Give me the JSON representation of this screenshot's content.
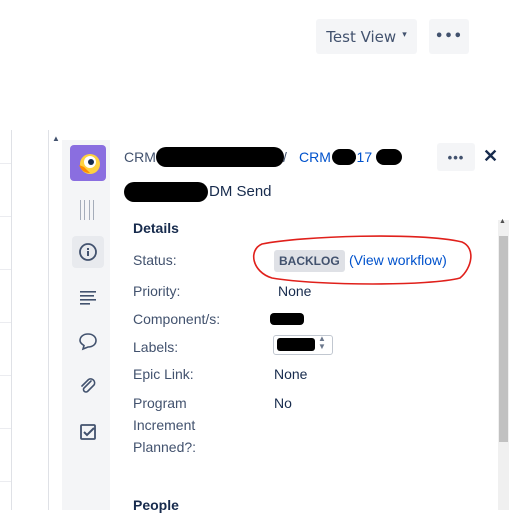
{
  "toolbar": {
    "view_label": "Test View",
    "view_caret": "▾",
    "more_label": "•••"
  },
  "panel": {
    "breadcrumb": {
      "project_prefix": "CRM",
      "separator": "/",
      "issue_prefix": "CRM",
      "issue_suffix": "-17"
    },
    "summary_visible": "DM Send",
    "more_label": "•••",
    "close_label": "✕",
    "details": {
      "heading": "Details",
      "status_label": "Status:",
      "status_value": "BACKLOG",
      "view_workflow": "(View workflow)",
      "priority_label": "Priority:",
      "priority_value": "None",
      "component_label": "Component/s:",
      "labels_label": "Labels:",
      "epic_label": "Epic Link:",
      "epic_value": "None",
      "pi_label_line1": "Program",
      "pi_label_line2": "Increment",
      "pi_label_line3": "Planned?:",
      "pi_value": "No"
    },
    "people_heading": "People"
  },
  "rail_icons": [
    "logo-icon",
    "drag-handle-icon",
    "info-icon",
    "description-icon",
    "comment-icon",
    "attachment-icon",
    "checklist-icon"
  ],
  "colors": {
    "accent": "#0052cc",
    "logo": "#8a6ee0",
    "annotation": "#e0201b",
    "lozenge": "#dfe1e6"
  }
}
